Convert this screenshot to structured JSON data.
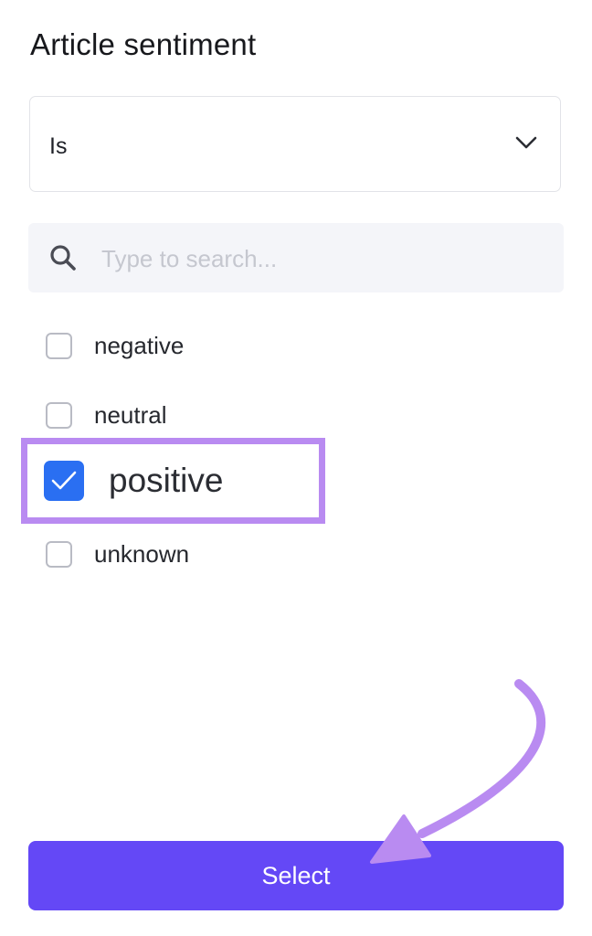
{
  "panel": {
    "title": "Article sentiment"
  },
  "operator": {
    "value": "Is",
    "icon": "chevron-down-icon"
  },
  "search": {
    "placeholder": "Type to search...",
    "value": "",
    "icon": "search-icon"
  },
  "options": [
    {
      "label": "negative",
      "checked": false
    },
    {
      "label": "neutral",
      "checked": false
    },
    {
      "label": "positive",
      "checked": true
    },
    {
      "label": "unknown",
      "checked": false
    }
  ],
  "actions": {
    "select_label": "Select"
  },
  "colors": {
    "accent": "#6448f6",
    "checkbox_checked": "#2a6ff2",
    "annotation": "#b98bf1"
  }
}
